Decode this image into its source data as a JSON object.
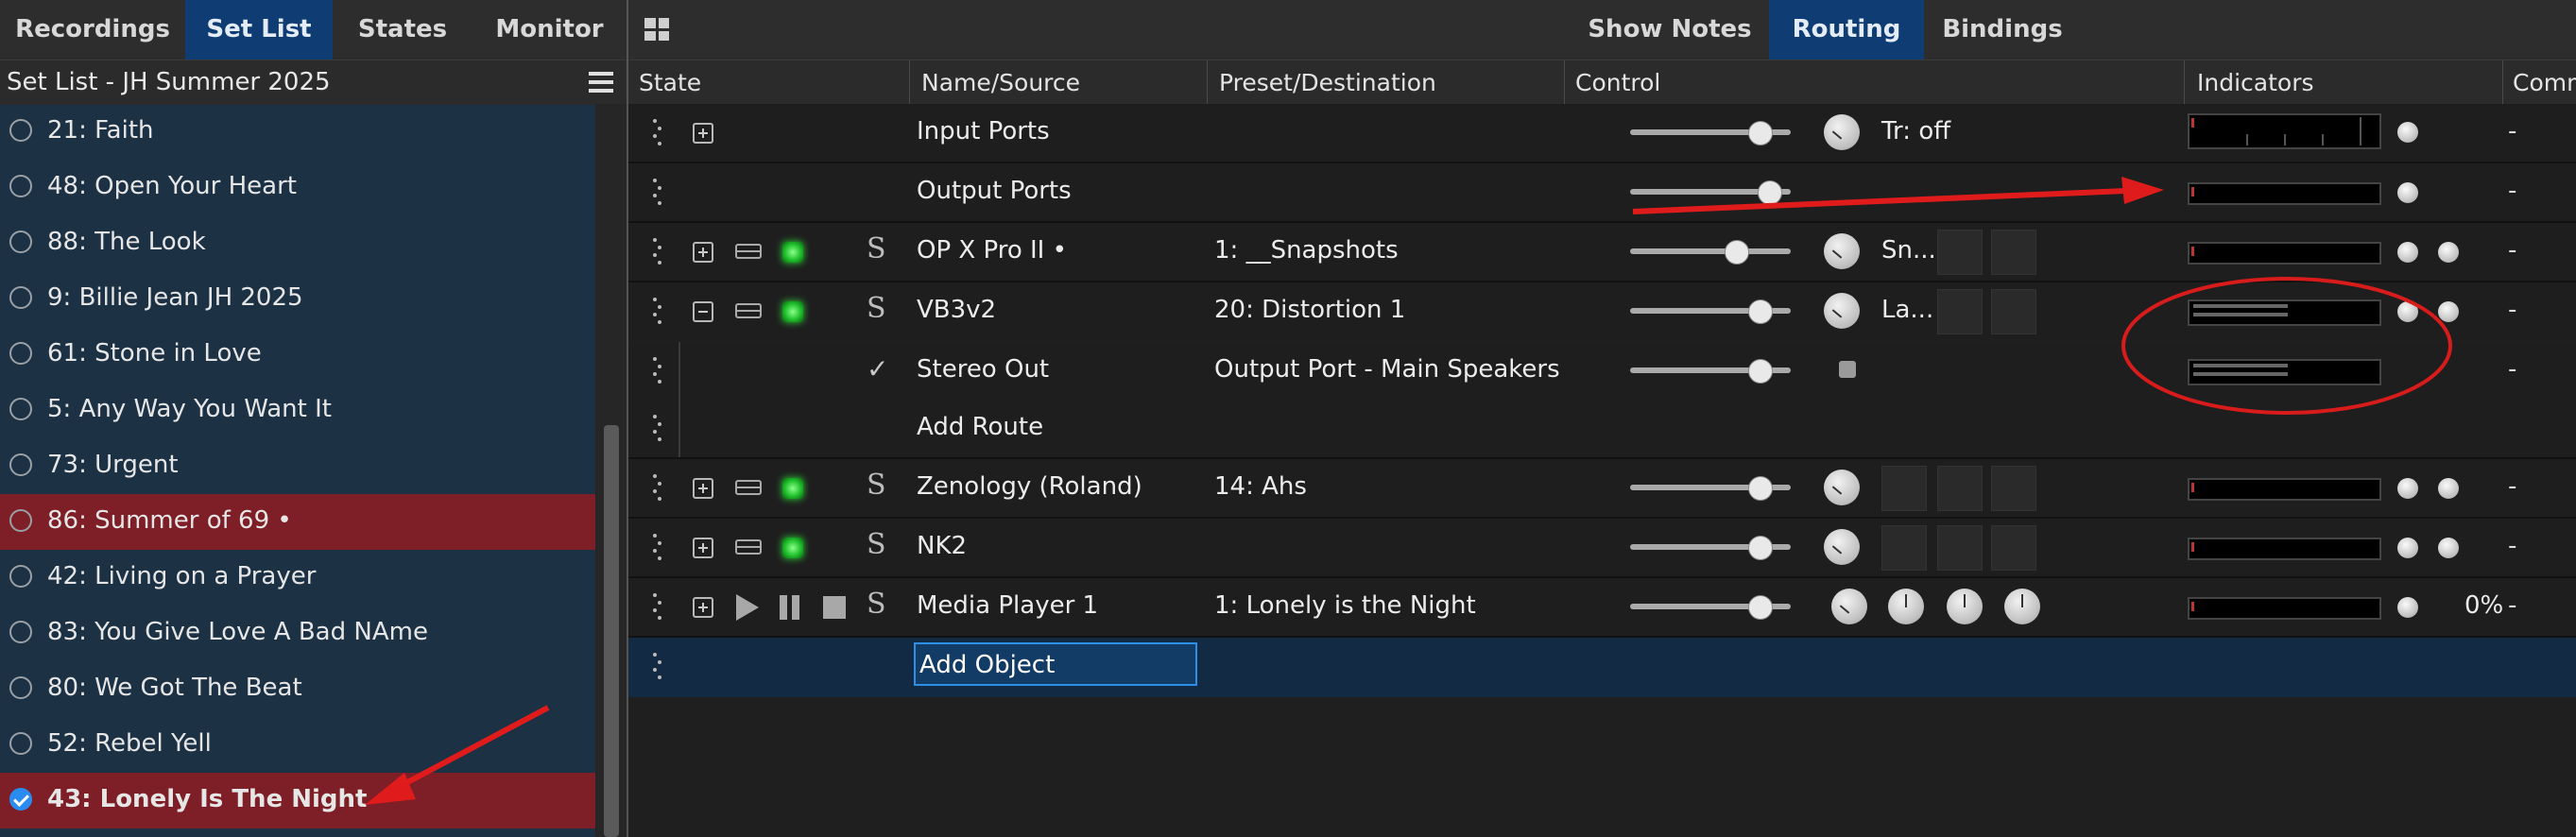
{
  "left_tabs": [
    "Recordings",
    "Set List",
    "States",
    "Monitor"
  ],
  "setlist": {
    "title": "Set List - JH Summer 2025",
    "songs": [
      "21: Faith",
      "48: Open Your Heart",
      "88: The Look",
      "9: Billie Jean JH 2025",
      "61: Stone in Love",
      "5: Any Way You Want It",
      "73: Urgent",
      "86: Summer of 69 •",
      "42: Living on a Prayer",
      "83: You Give Love A Bad NAme",
      "80: We Got The Beat",
      "52: Rebel Yell",
      "43: Lonely Is The Night •"
    ]
  },
  "right_tabs": [
    "Show Notes",
    "Routing",
    "Bindings"
  ],
  "columns": [
    "State",
    "Name/Source",
    "Preset/Destination",
    "Control",
    "Indicators",
    "Comm"
  ],
  "rows": [
    {
      "name": "Input Ports",
      "preset": "",
      "control_text": "Tr: off",
      "comment": "-"
    },
    {
      "name": "Output Ports",
      "preset": "",
      "control_text": "",
      "comment": "-"
    },
    {
      "name": "OP X Pro II •",
      "preset": "1: __Snapshots",
      "control_text": "Sn...",
      "comment": "-"
    },
    {
      "name": "VB3v2",
      "preset": "20: Distortion 1",
      "control_text": "La...",
      "comment": "-"
    },
    {
      "name": "Stereo Out",
      "preset": "Output Port - Main Speakers",
      "control_text": "",
      "comment": "-"
    },
    {
      "name": "Add Route",
      "preset": "",
      "control_text": "",
      "comment": ""
    },
    {
      "name": "Zenology (Roland)",
      "preset": "14: Ahs",
      "control_text": "",
      "comment": "-"
    },
    {
      "name": "NK2",
      "preset": "",
      "control_text": "",
      "comment": "-"
    },
    {
      "name": "Media Player 1",
      "preset": "1: Lonely is the Night",
      "control_text": "",
      "indicator_text": "0%",
      "comment": "-"
    }
  ],
  "add_object": "Add Object",
  "colors": {
    "accent_tab": "#0e3c73",
    "highlight_row": "#7e1e26",
    "annotation": "#e01b1b",
    "led": "#1fbf2b"
  }
}
